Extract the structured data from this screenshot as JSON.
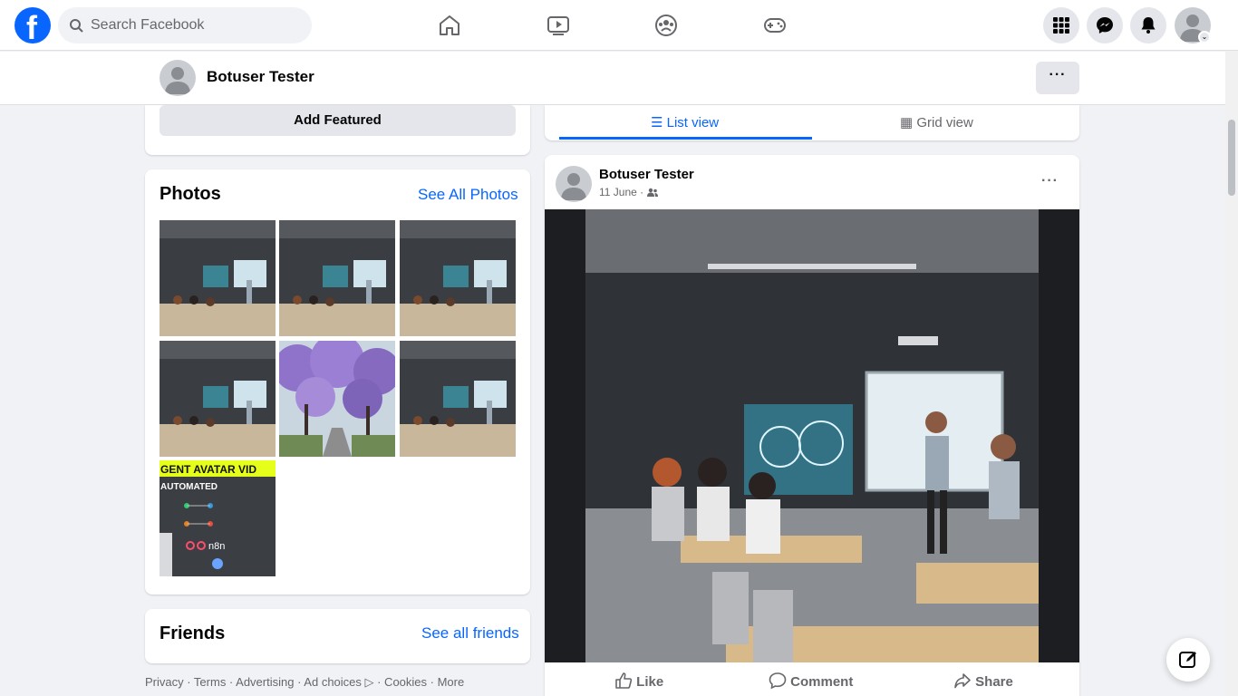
{
  "topbar": {
    "logo_letter": "f",
    "search_placeholder": "Search Facebook",
    "nav_icons": [
      "home-icon",
      "video-icon",
      "groups-icon",
      "gaming-icon"
    ],
    "right_icons": [
      "menu-grid-icon",
      "messenger-icon",
      "notifications-icon",
      "account-avatar"
    ]
  },
  "profile_bar": {
    "name": "Botuser Tester",
    "more_label": "···"
  },
  "featured": {
    "add_label": "Add Featured"
  },
  "photos": {
    "title": "Photos",
    "see_all": "See All Photos",
    "items": [
      "classroom",
      "classroom",
      "classroom",
      "classroom",
      "jacaranda-trees",
      "classroom",
      "agent-avatar"
    ],
    "agent_thumb_text_1": "GENT AVATAR VID",
    "agent_thumb_text_2": "AUTOMATED",
    "agent_thumb_text_3": "n8n"
  },
  "friends": {
    "title": "Friends",
    "see_all": "See all friends"
  },
  "footer": {
    "links": "Privacy · Terms · Advertising · Ad choices ▷ · Cookies · More"
  },
  "view_tabs": {
    "list": "List view",
    "grid": "Grid view",
    "active": "list"
  },
  "post": {
    "author": "Botuser Tester",
    "date": "11 June ·",
    "more_label": "···",
    "actions": {
      "like": "Like",
      "comment": "Comment",
      "share": "Share"
    }
  },
  "colors": {
    "brand": "#0866ff",
    "background": "#f0f2f5",
    "muted_text": "#65676b"
  }
}
